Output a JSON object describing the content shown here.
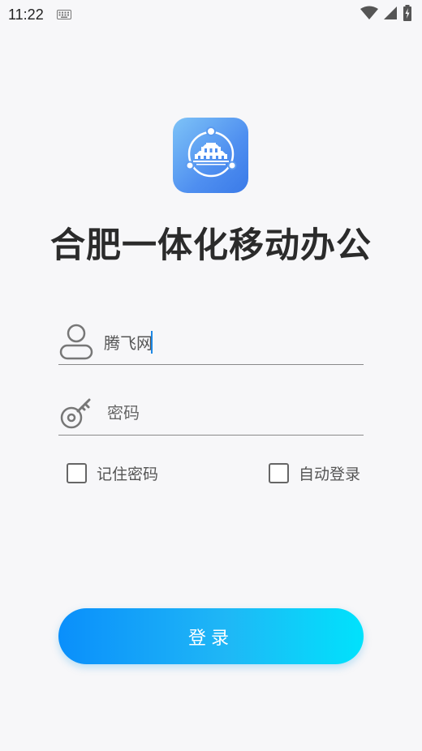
{
  "status_bar": {
    "time": "11:22"
  },
  "app": {
    "title": "合肥一体化移动办公",
    "logo_icon": "city-building-logo-icon"
  },
  "form": {
    "username": {
      "value": "腾飞网",
      "icon": "user-icon"
    },
    "password": {
      "placeholder": "密码",
      "icon": "key-icon"
    },
    "remember_password_label": "记住密码",
    "auto_login_label": "自动登录",
    "login_label": "登录"
  },
  "colors": {
    "button_gradient_start": "#0a8ffb",
    "button_gradient_end": "#00e2fc",
    "logo_gradient": "#4f8ff0",
    "caret": "#1e88e5"
  }
}
